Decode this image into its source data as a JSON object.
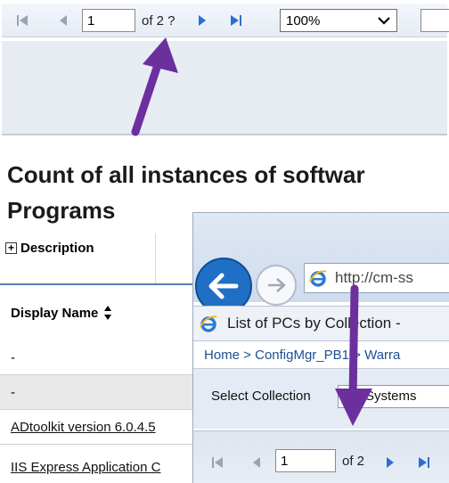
{
  "toolbar": {
    "page_value": "1",
    "of_text": "of 2 ?",
    "zoom_value": "100%"
  },
  "report": {
    "title_line1": "Count of all instances of softwar",
    "title_line2": "Programs",
    "description_label": "Description",
    "column_header": "Display Name",
    "rows": [
      "-",
      "-",
      "ADtoolkit version 6.0.4.5",
      "IIS Express Application C"
    ]
  },
  "overlay": {
    "address_text": "http://cm-ss",
    "tab_title": "List of PCs by Collection -",
    "breadcrumb": "Home > ConfigMgr_PB1 > Warra",
    "select_label": "Select Collection",
    "select_value": "Systems",
    "page_value": "1",
    "of_text": "of 2"
  },
  "colors": {
    "accent_purple": "#6b2f9e",
    "link_blue": "#1d4f91",
    "back_button": "#1f6fc5"
  }
}
